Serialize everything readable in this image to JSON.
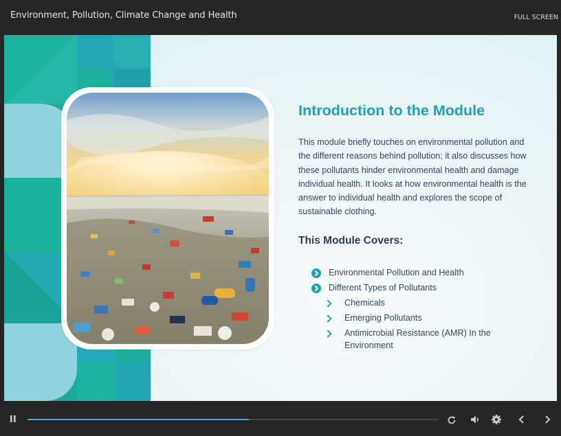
{
  "header": {
    "course_title": "Environment, Pollution, Climate Change and Health",
    "fullscreen_label": "FULL SCREEN"
  },
  "slide": {
    "heading": "Introduction to the Module",
    "intro": "This module briefly touches on environmental pollution and the different reasons behind pollution; it also discusses how these pollutants hinder environmental health and damage individual health. It looks at how environmental health is the answer to individual health and explores the scope of sustainable clothing.",
    "covers_heading": "This Module Covers:",
    "list": [
      {
        "label": "Environmental Pollution and Health",
        "icon": "chevron-circle-icon"
      },
      {
        "label": "Different Types of Pollutants",
        "icon": "chevron-circle-icon"
      },
      {
        "label": "Chemicals",
        "icon": "chevron-right-icon"
      },
      {
        "label": "Emerging Pollutants",
        "icon": "chevron-right-icon"
      },
      {
        "label": "Antimicrobial Resistance (AMR) In the Environment",
        "icon": "chevron-right-icon"
      }
    ],
    "image": "plastic-waste-landfill-photo",
    "accent_color": "#1ea3b1"
  },
  "player": {
    "progress": 0.54,
    "icons": [
      "pause-icon",
      "replay-icon",
      "volume-icon",
      "settings-icon",
      "previous-icon",
      "next-icon"
    ],
    "progress_color": "#4aa6e8"
  }
}
